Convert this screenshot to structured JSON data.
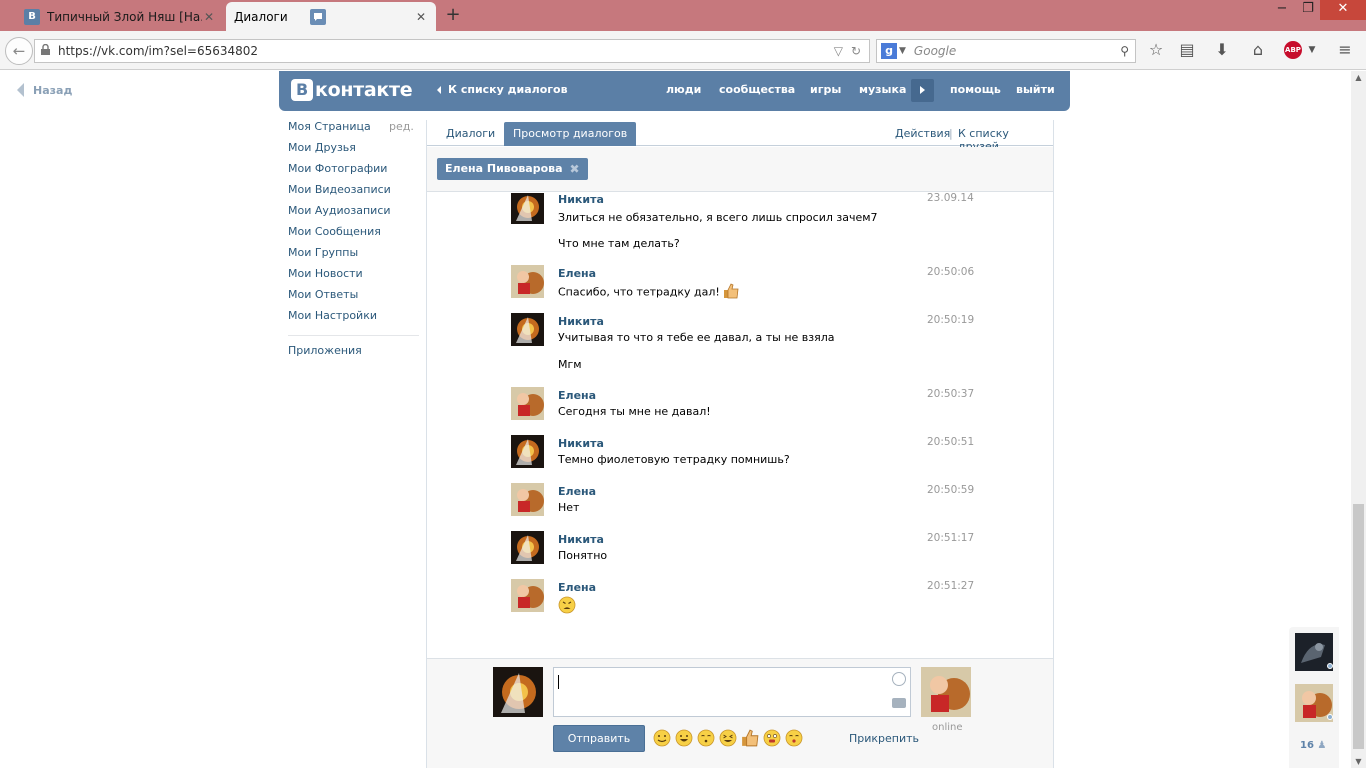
{
  "browser": {
    "tabs": [
      {
        "title": "Типичный Злой Няш [На...",
        "favicon": "B",
        "active": false
      },
      {
        "title": "Диалоги",
        "favicon": "message-icon",
        "active": true
      }
    ],
    "url": "https://vk.com/im?sel=65634802",
    "search_placeholder": "Google"
  },
  "page": {
    "back_label": "Назад",
    "header": {
      "logo": "контакте",
      "back_to_dialogs": "К списку диалогов",
      "nav": [
        "люди",
        "сообщества",
        "игры",
        "музыка",
        "помощь",
        "выйти"
      ]
    },
    "sidebar": {
      "edit_label": "ред.",
      "items": [
        "Моя Страница",
        "Мои Друзья",
        "Мои Фотографии",
        "Мои Видеозаписи",
        "Мои Аудиозаписи",
        "Мои Сообщения",
        "Мои Группы",
        "Мои Новости",
        "Мои Ответы",
        "Мои Настройки"
      ],
      "apps": "Приложения"
    },
    "tabs": {
      "dialogs": "Диалоги",
      "view_dialogs": "Просмотр диалогов",
      "actions": "Действия",
      "friends_list": "К списку друзей"
    },
    "chip": "Елена Пивоварова",
    "messages": [
      {
        "author": "Никита",
        "time": "23.09.14",
        "lines": [
          "Злиться не обязательно, я всего лишь спросил зачем7",
          "Что мне там делать?"
        ]
      },
      {
        "author": "Елена",
        "time": "20:50:06",
        "lines": [
          "Спасибо, что тетрадку дал!"
        ]
      },
      {
        "author": "Никита",
        "time": "20:50:19",
        "lines": [
          "Учитывая то что я тебе ее давал, а ты не взяла",
          "Мгм"
        ]
      },
      {
        "author": "Елена",
        "time": "20:50:37",
        "lines": [
          "Сегодня ты мне не давал!"
        ]
      },
      {
        "author": "Никита",
        "time": "20:50:51",
        "lines": [
          "Темно фиолетовую тетрадку помнишь?"
        ]
      },
      {
        "author": "Елена",
        "time": "20:50:59",
        "lines": [
          "Нет"
        ]
      },
      {
        "author": "Никита",
        "time": "20:51:17",
        "lines": [
          "Понятно"
        ]
      },
      {
        "author": "Елена",
        "time": "20:51:27",
        "lines": [
          ""
        ]
      }
    ],
    "composer": {
      "send": "Отправить",
      "attach": "Прикрепить",
      "online": "online"
    },
    "friends_count": "16"
  },
  "colors": {
    "vk_blue": "#5b7fa6",
    "link": "#2b587a",
    "titlebar": "#c6787d"
  }
}
